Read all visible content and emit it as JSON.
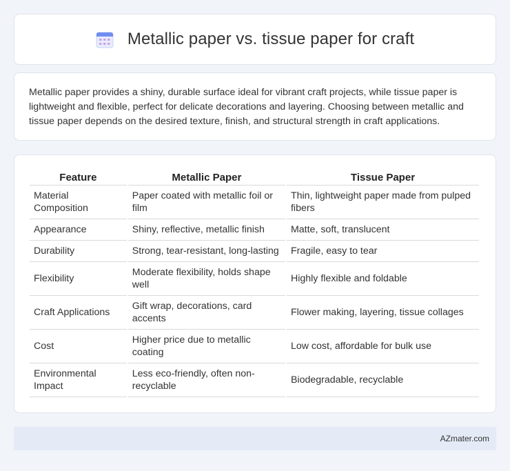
{
  "header": {
    "title": "Metallic paper vs. tissue paper for craft",
    "icon": "calendar-icon"
  },
  "intro": {
    "text": "Metallic paper provides a shiny, durable surface ideal for vibrant craft projects, while tissue paper is lightweight and flexible, perfect for delicate decorations and layering. Choosing between metallic and tissue paper depends on the desired texture, finish, and structural strength in craft applications."
  },
  "table": {
    "headers": [
      "Feature",
      "Metallic Paper",
      "Tissue Paper"
    ],
    "rows": [
      [
        "Material Composition",
        "Paper coated with metallic foil or film",
        "Thin, lightweight paper made from pulped fibers"
      ],
      [
        "Appearance",
        "Shiny, reflective, metallic finish",
        "Matte, soft, translucent"
      ],
      [
        "Durability",
        "Strong, tear-resistant, long-lasting",
        "Fragile, easy to tear"
      ],
      [
        "Flexibility",
        "Moderate flexibility, holds shape well",
        "Highly flexible and foldable"
      ],
      [
        "Craft Applications",
        "Gift wrap, decorations, card accents",
        "Flower making, layering, tissue collages"
      ],
      [
        "Cost",
        "Higher price due to metallic coating",
        "Low cost, affordable for bulk use"
      ],
      [
        "Environmental Impact",
        "Less eco-friendly, often non-recyclable",
        "Biodegradable, recyclable"
      ]
    ]
  },
  "footer": {
    "brand": "AZmater.com"
  },
  "colors": {
    "background": "#f1f4f9",
    "card": "#ffffff",
    "footer": "#e5ebf6",
    "icon_primary": "#6f8ef0",
    "icon_accent": "#c9a3ea"
  }
}
